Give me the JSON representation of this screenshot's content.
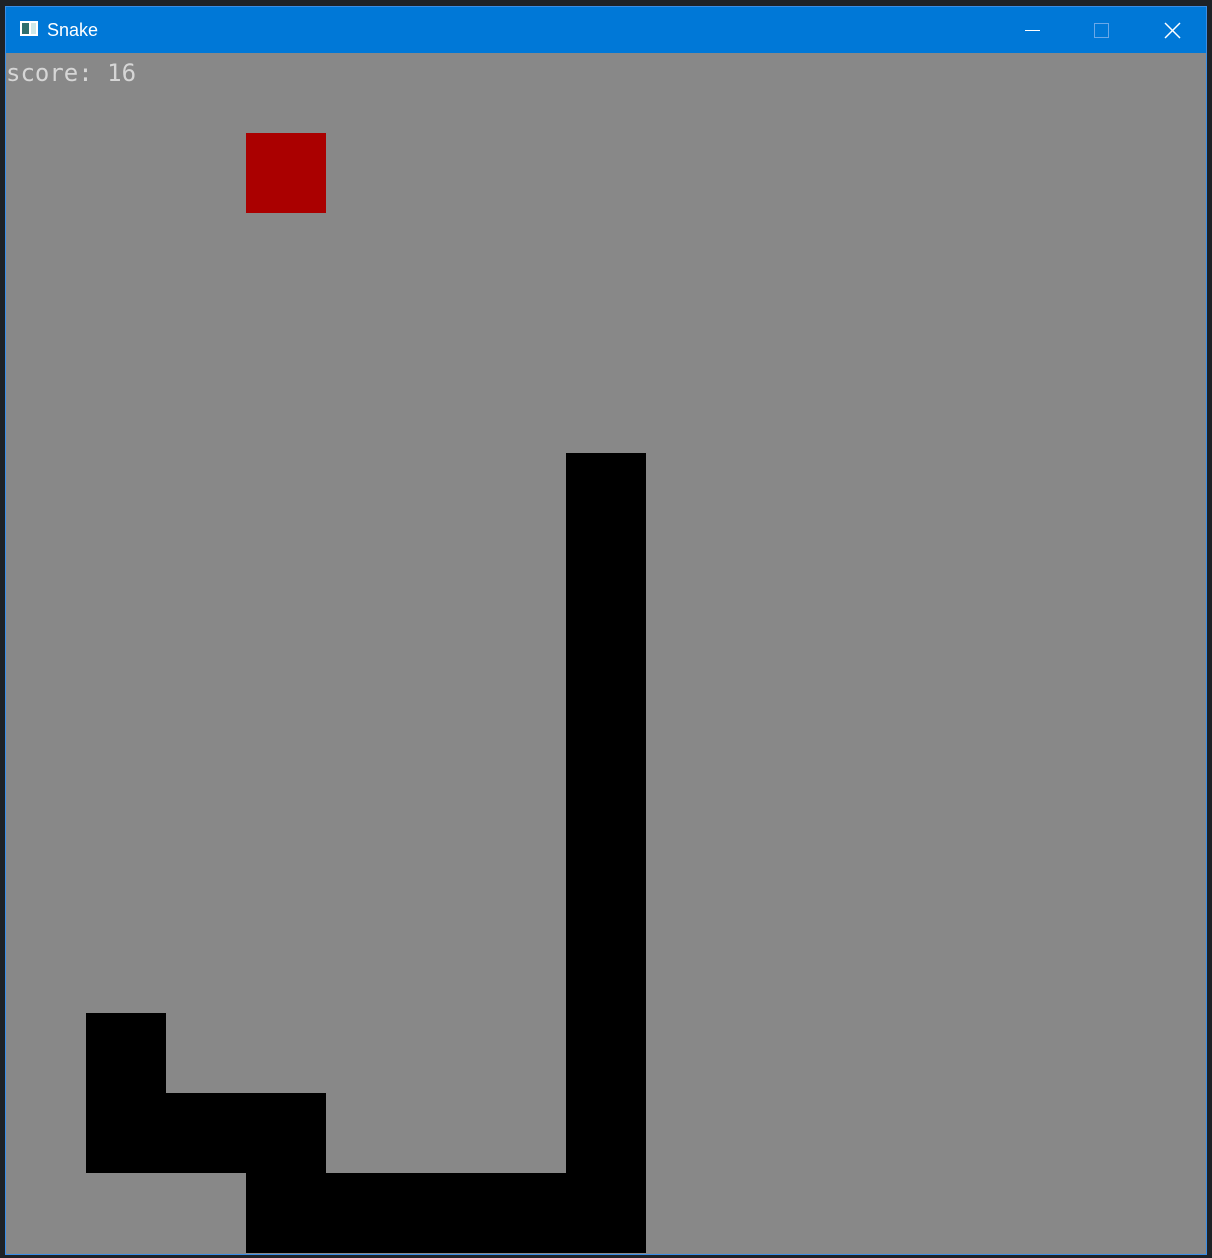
{
  "window": {
    "title": "Snake",
    "titlebar_color": "#0078d7",
    "controls": [
      "minimize-icon",
      "maximize-icon",
      "close-icon"
    ]
  },
  "game": {
    "score_text": "score: 16",
    "background_color": "#888888",
    "snake_color": "#000000",
    "food_color": "#aa0000",
    "grid": {
      "columns": 15,
      "rows": 15
    },
    "food": {
      "col": 3,
      "row": 1
    },
    "snake_segments": [
      {
        "col": 7,
        "row": 5
      },
      {
        "col": 7,
        "row": 6
      },
      {
        "col": 7,
        "row": 7
      },
      {
        "col": 7,
        "row": 8
      },
      {
        "col": 7,
        "row": 9
      },
      {
        "col": 7,
        "row": 10
      },
      {
        "col": 7,
        "row": 11
      },
      {
        "col": 7,
        "row": 12
      },
      {
        "col": 7,
        "row": 13
      },
      {
        "col": 7,
        "row": 14
      },
      {
        "col": 6,
        "row": 14
      },
      {
        "col": 5,
        "row": 14
      },
      {
        "col": 4,
        "row": 14
      },
      {
        "col": 3,
        "row": 14
      },
      {
        "col": 3,
        "row": 13
      },
      {
        "col": 2,
        "row": 13
      },
      {
        "col": 1,
        "row": 13
      },
      {
        "col": 1,
        "row": 12
      }
    ]
  }
}
